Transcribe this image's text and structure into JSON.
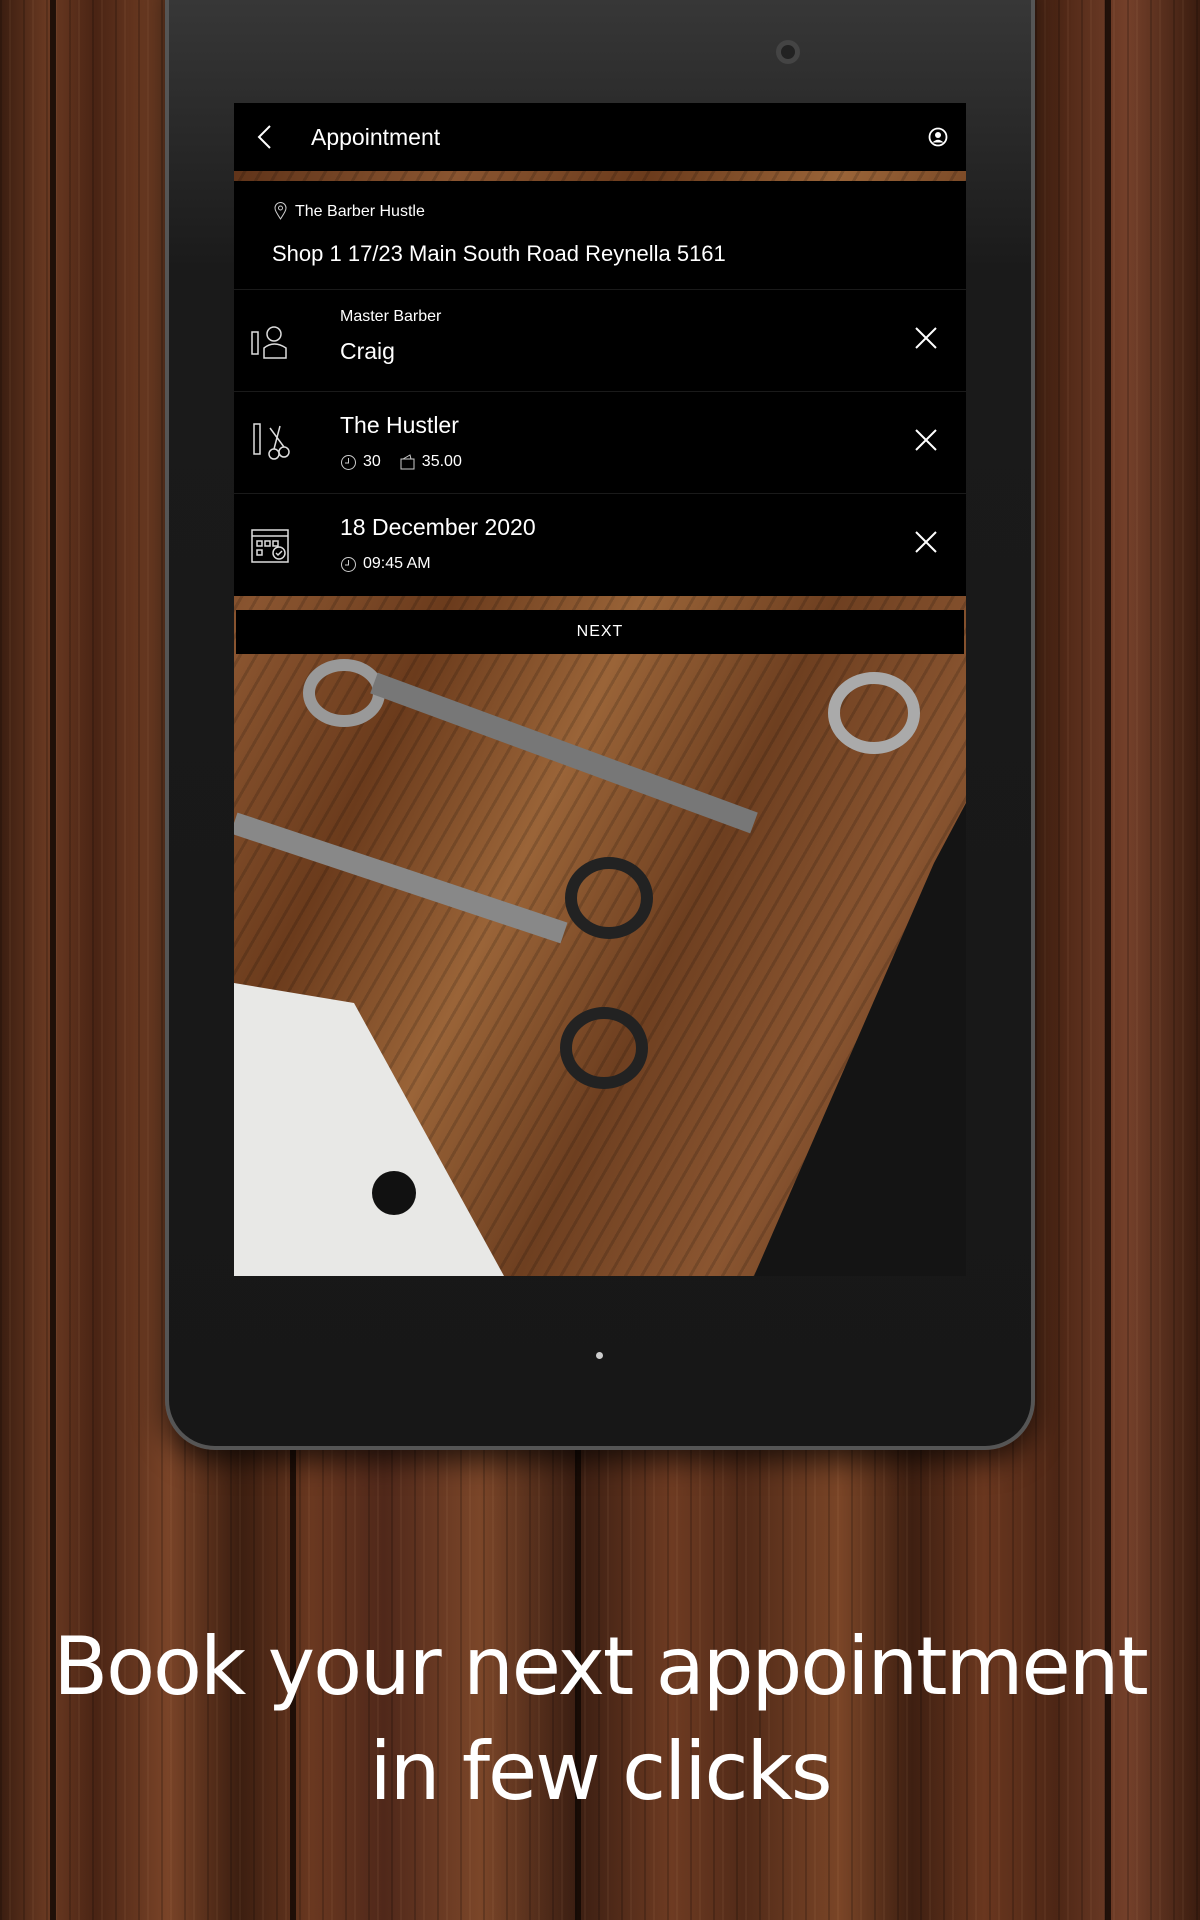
{
  "header": {
    "title": "Appointment",
    "back_icon": "chevron-left-icon",
    "profile_icon": "user-circle-icon"
  },
  "location": {
    "name": "The Barber Hustle",
    "address": "Shop 1 17/23 Main South Road Reynella 5161",
    "icon": "map-pin-icon"
  },
  "barber": {
    "label": "Master Barber",
    "name": "Craig",
    "icon": "barber-icon"
  },
  "service": {
    "name": "The Hustler",
    "duration": "30",
    "price": "35.00",
    "icon": "comb-scissors-icon"
  },
  "datetime": {
    "date": "18 December 2020",
    "time": "09:45 AM",
    "icon": "calendar-check-icon"
  },
  "next_label": "NEXT",
  "caption": {
    "line1": "Book your next appointment",
    "line2": "in few clicks"
  }
}
